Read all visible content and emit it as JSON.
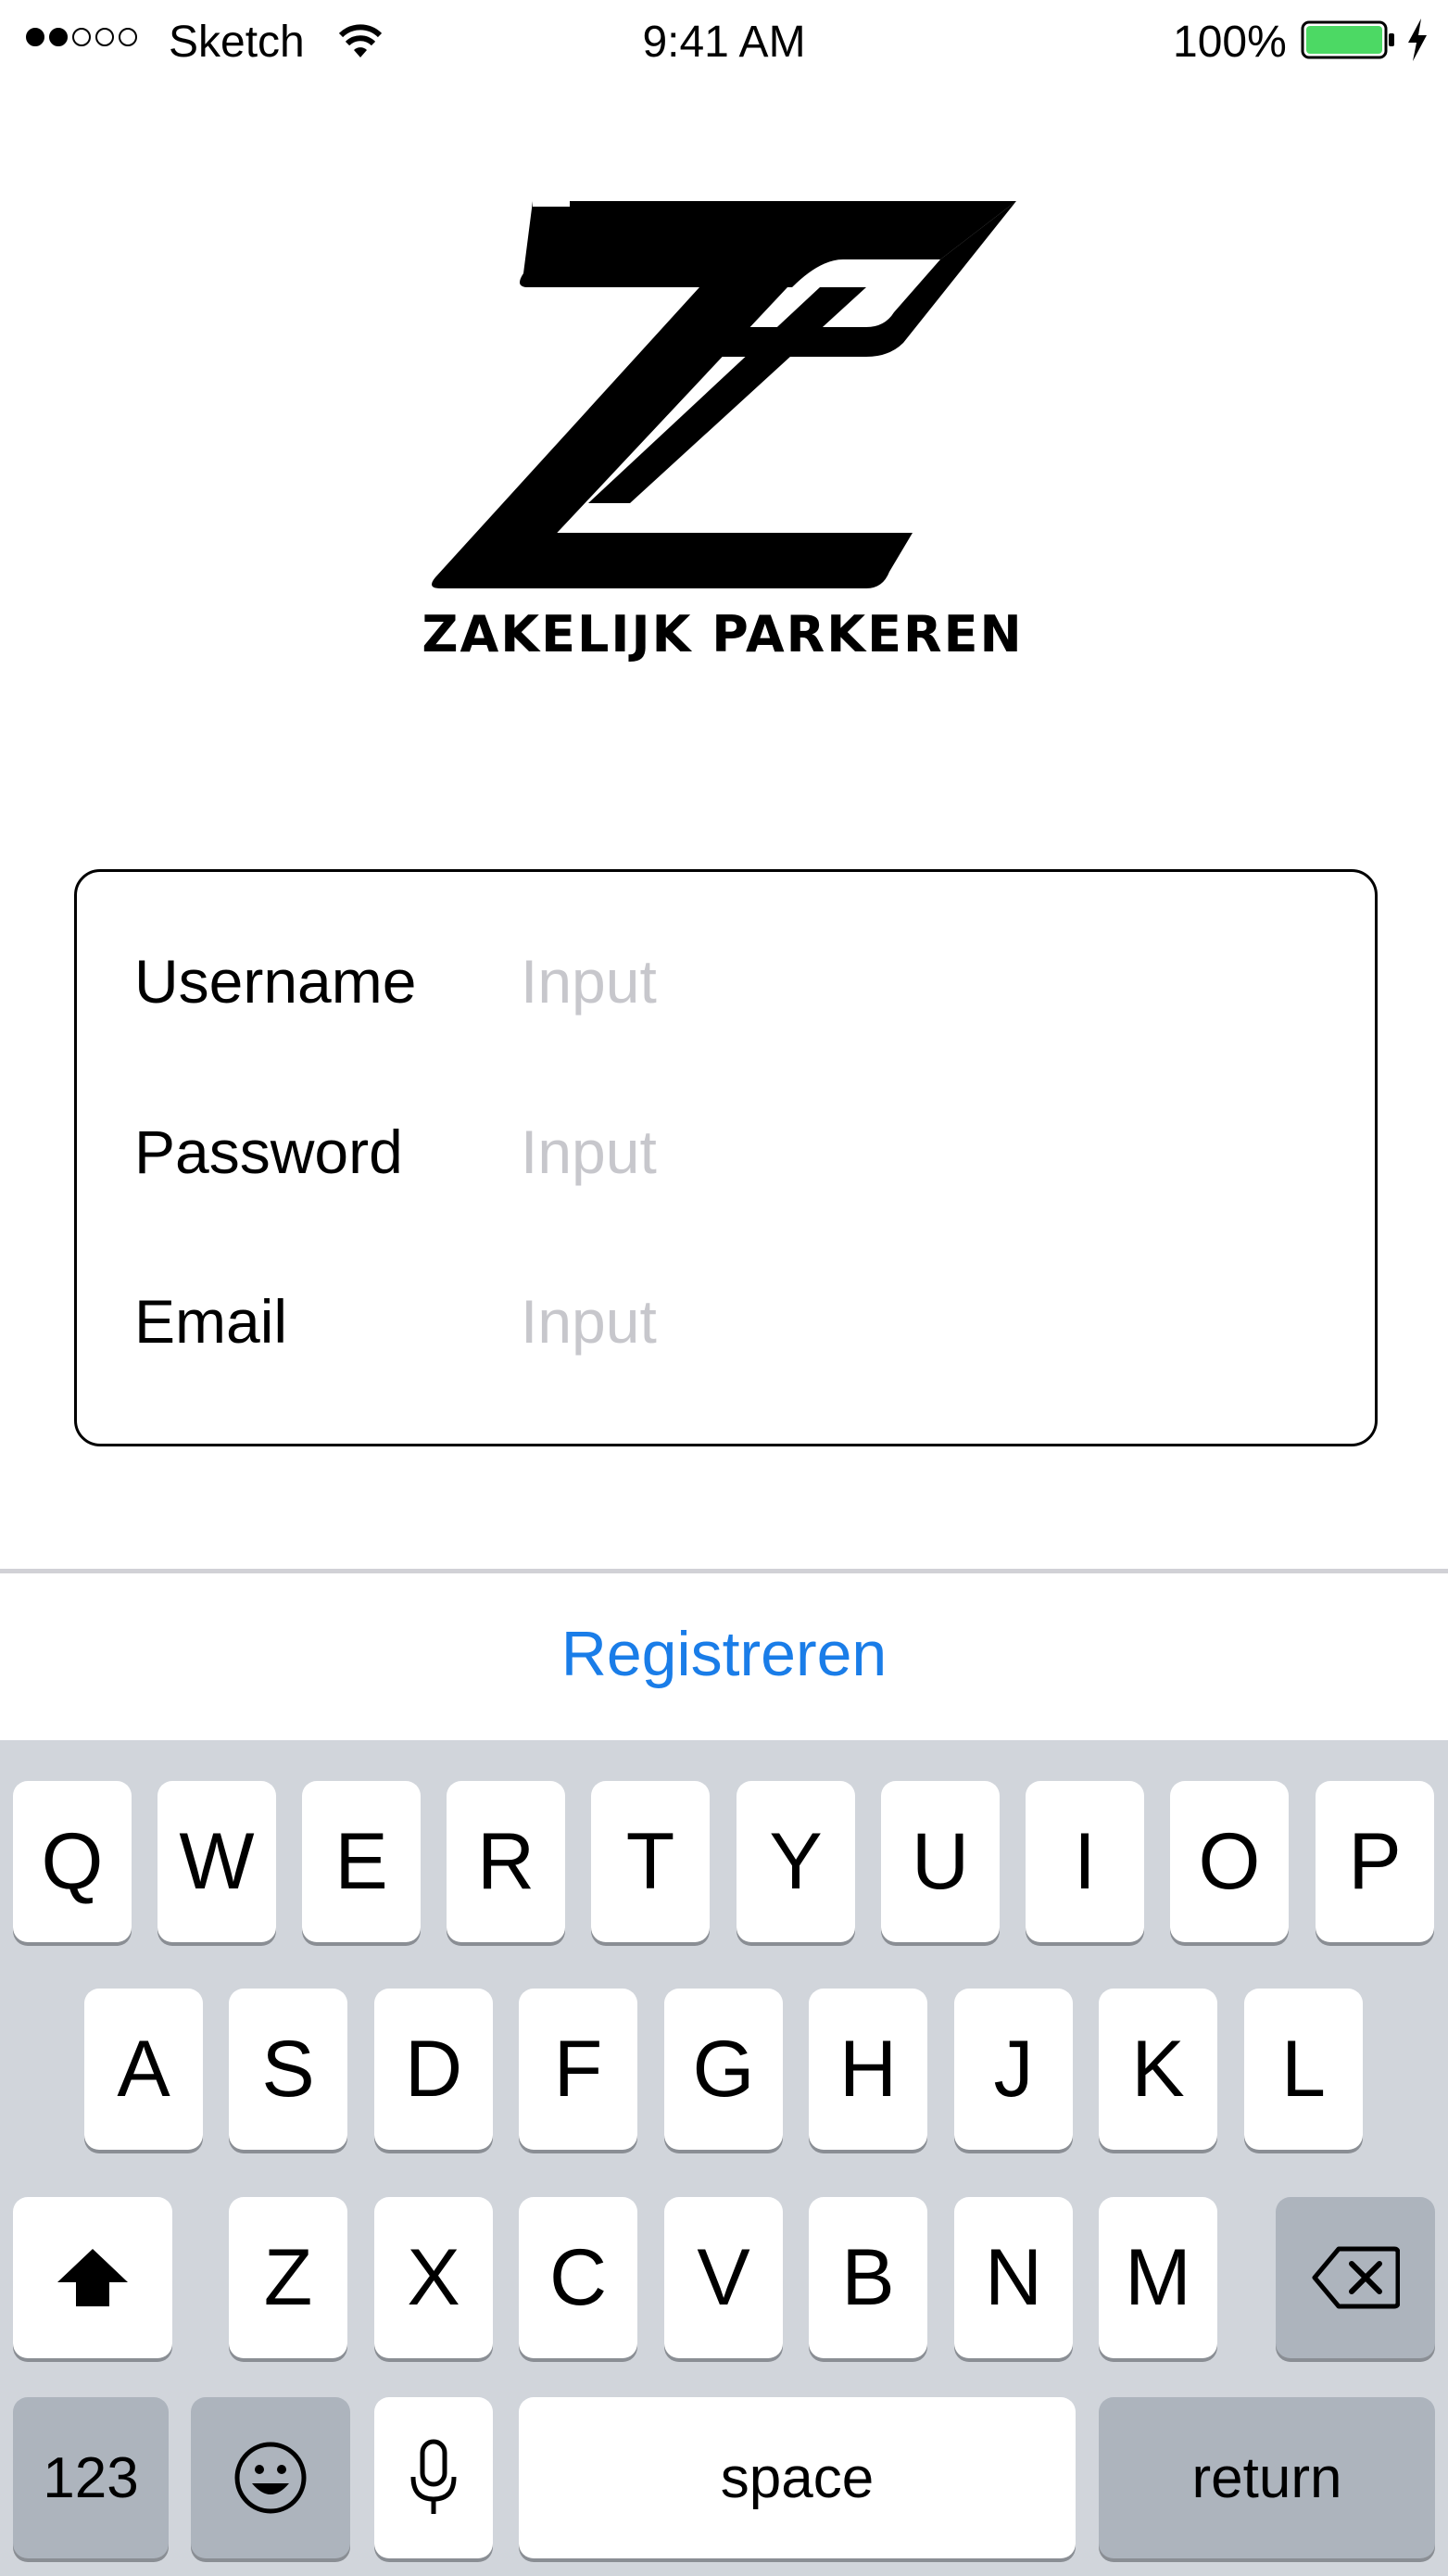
{
  "status_bar": {
    "carrier": "Sketch",
    "time": "9:41 AM",
    "battery_percent": "100%",
    "signal_bars_filled": 2,
    "signal_bars_total": 5,
    "battery_color": "#4cd964"
  },
  "logo": {
    "text": "ZAKELIJK PARKEREN"
  },
  "form": {
    "fields": [
      {
        "label": "Username",
        "placeholder": "Input"
      },
      {
        "label": "Password",
        "placeholder": "Input"
      },
      {
        "label": "Email",
        "placeholder": "Input"
      }
    ]
  },
  "register": {
    "label": "Registreren",
    "color": "#1a7de8"
  },
  "keyboard": {
    "row1": [
      "Q",
      "W",
      "E",
      "R",
      "T",
      "Y",
      "U",
      "I",
      "O",
      "P"
    ],
    "row2": [
      "A",
      "S",
      "D",
      "F",
      "G",
      "H",
      "J",
      "K",
      "L"
    ],
    "row3": [
      "Z",
      "X",
      "C",
      "V",
      "B",
      "N",
      "M"
    ],
    "shift_icon": "shift-arrow-icon",
    "delete_icon": "backspace-icon",
    "numbers_label": "123",
    "emoji_icon": "emoji-icon",
    "mic_icon": "microphone-icon",
    "space_label": "space",
    "return_label": "return"
  }
}
